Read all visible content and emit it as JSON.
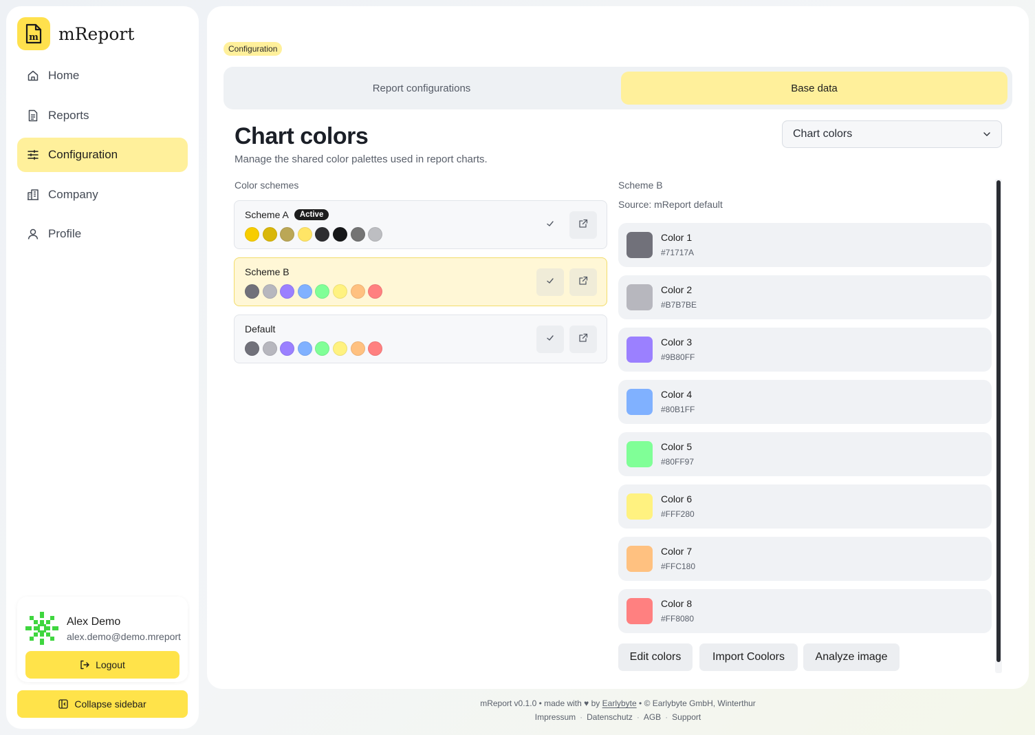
{
  "app": {
    "name": "mReport"
  },
  "sidebar": {
    "items": [
      {
        "label": "Home",
        "icon": "home-icon"
      },
      {
        "label": "Reports",
        "icon": "document-icon"
      },
      {
        "label": "Configuration",
        "icon": "sliders-icon",
        "active": true
      },
      {
        "label": "Company",
        "icon": "building-icon"
      },
      {
        "label": "Profile",
        "icon": "user-icon"
      }
    ],
    "user": {
      "name": "Alex Demo",
      "email": "alex.demo@demo.mreport"
    },
    "logout_label": "Logout",
    "collapse_label": "Collapse sidebar"
  },
  "breadcrumb": "Configuration",
  "tabs": [
    {
      "label": "Report configurations",
      "active": false
    },
    {
      "label": "Base data",
      "active": true
    }
  ],
  "page": {
    "title": "Chart colors",
    "subtitle": "Manage the shared color palettes used in report charts.",
    "select_value": "Chart colors"
  },
  "schemes": {
    "label": "Color schemes",
    "items": [
      {
        "name": "Scheme A",
        "badge": "Active",
        "colors": [
          "#F7CD00",
          "#D9B70B",
          "#BBA756",
          "#FFE566",
          "#2D2D30",
          "#17181A",
          "#747474",
          "#BDBEC2"
        ]
      },
      {
        "name": "Scheme B",
        "selected": true,
        "colors": [
          "#71717A",
          "#B7B7BE",
          "#9B80FF",
          "#80B1FF",
          "#80FF97",
          "#FFF280",
          "#FFC180",
          "#FF8080"
        ]
      },
      {
        "name": "Default",
        "colors": [
          "#71717A",
          "#B7B7BE",
          "#9B80FF",
          "#80B1FF",
          "#80FF97",
          "#FFF280",
          "#FFC180",
          "#FF8080"
        ]
      }
    ]
  },
  "detail": {
    "title": "Scheme B",
    "source": "Source: mReport default",
    "colors": [
      {
        "name": "Color 1",
        "hex": "#71717A"
      },
      {
        "name": "Color 2",
        "hex": "#B7B7BE"
      },
      {
        "name": "Color 3",
        "hex": "#9B80FF"
      },
      {
        "name": "Color 4",
        "hex": "#80B1FF"
      },
      {
        "name": "Color 5",
        "hex": "#80FF97"
      },
      {
        "name": "Color 6",
        "hex": "#FFF280"
      },
      {
        "name": "Color 7",
        "hex": "#FFC180"
      },
      {
        "name": "Color 8",
        "hex": "#FF8080"
      }
    ],
    "actions": [
      "Edit colors",
      "Import Coolors",
      "Analyze image"
    ]
  },
  "footer": {
    "text_before": "mReport v0.1.0 • made with",
    "by": "by",
    "link": "Earlybyte",
    "text_after": "• © Earlybyte GmbH, Winterthur",
    "links": [
      "Impressum",
      "Datenschutz",
      "AGB",
      "Support"
    ]
  },
  "colors": {
    "accent": "#FFE34A",
    "accent_soft": "#FFF09B"
  }
}
